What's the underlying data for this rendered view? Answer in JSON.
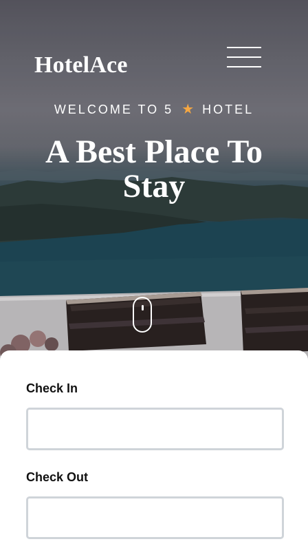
{
  "brand": {
    "name": "HotelAce"
  },
  "hero": {
    "welcome_prefix": "WELCOME TO 5",
    "welcome_star": "★",
    "welcome_suffix": "HOTEL",
    "headline_line1": "A Best Place To",
    "headline_line2": "Stay"
  },
  "icons": {
    "menu": "hamburger-menu-icon",
    "star": "star-icon",
    "scroll": "mouse-scroll-icon"
  },
  "colors": {
    "star": "#f5a742",
    "input_border": "#cfd4d9",
    "text_dark": "#111111"
  },
  "booking": {
    "check_in_label": "Check In",
    "check_in_value": "",
    "check_out_label": "Check Out",
    "check_out_value": ""
  }
}
